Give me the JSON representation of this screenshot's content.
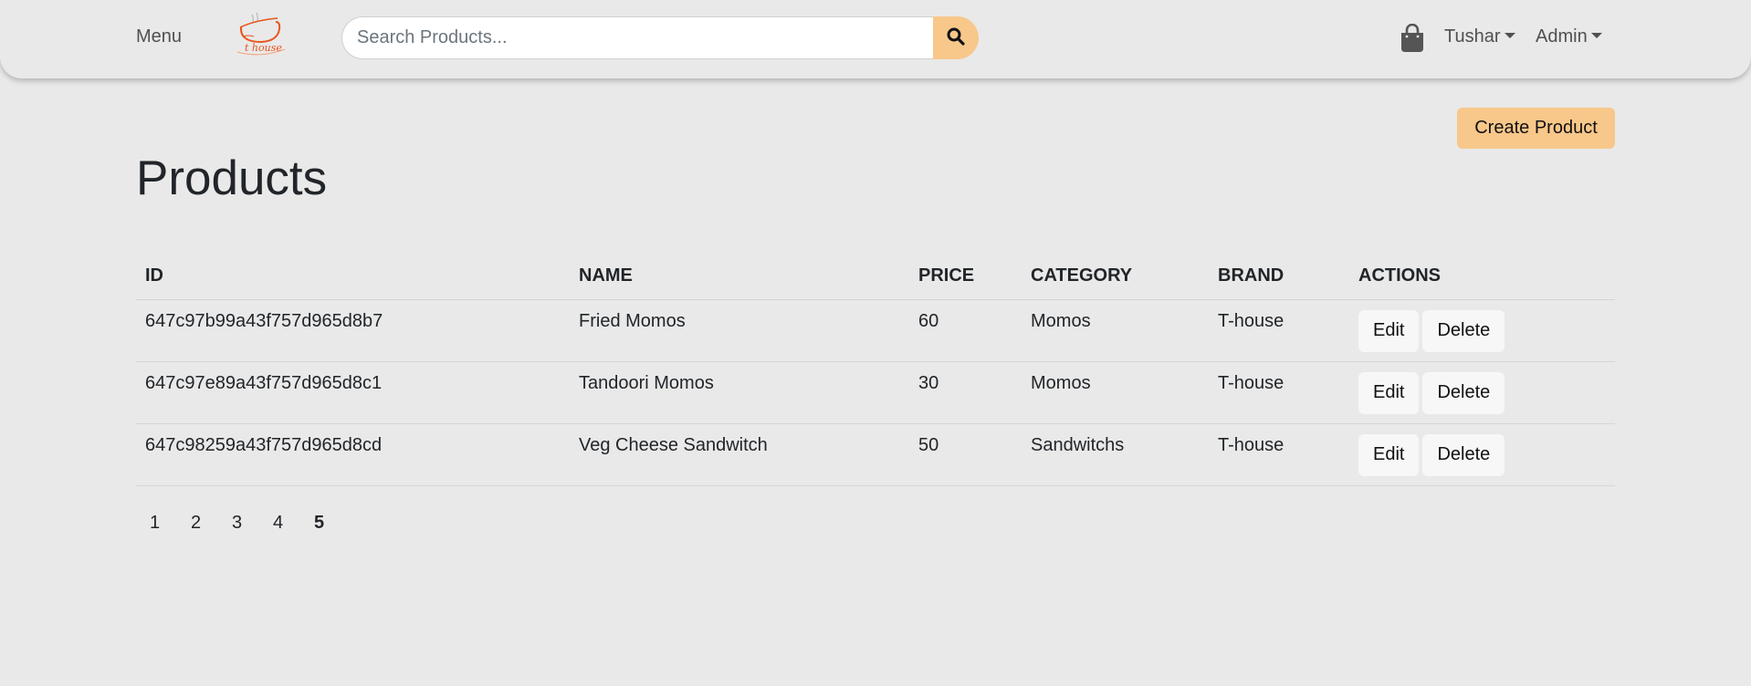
{
  "navbar": {
    "menu_label": "Menu",
    "logo_name": "thouse-logo",
    "search": {
      "placeholder": "Search Products...",
      "value": ""
    },
    "search_icon": "search-icon",
    "cart_icon": "shopping-bag-icon",
    "user_label": "Tushar",
    "admin_label": "Admin"
  },
  "main": {
    "create_label": "Create Product",
    "title": "Products",
    "table": {
      "headers": [
        "ID",
        "NAME",
        "PRICE",
        "CATEGORY",
        "BRAND",
        "ACTIONS"
      ],
      "rows": [
        {
          "id": "647c97b99a43f757d965d8b7",
          "name": "Fried Momos",
          "price": "60",
          "category": "Momos",
          "brand": "T-house"
        },
        {
          "id": "647c97e89a43f757d965d8c1",
          "name": "Tandoori Momos",
          "price": "30",
          "category": "Momos",
          "brand": "T-house"
        },
        {
          "id": "647c98259a43f757d965d8cd",
          "name": "Veg Cheese Sandwitch",
          "price": "50",
          "category": "Sandwitchs",
          "brand": "T-house"
        }
      ],
      "edit_label": "Edit",
      "delete_label": "Delete"
    },
    "pagination": {
      "pages": [
        "1",
        "2",
        "3",
        "4",
        "5"
      ],
      "active": "5"
    }
  },
  "colors": {
    "background": "#e9e9e9",
    "accent": "#f8c78a",
    "logo": "#e8551d"
  }
}
